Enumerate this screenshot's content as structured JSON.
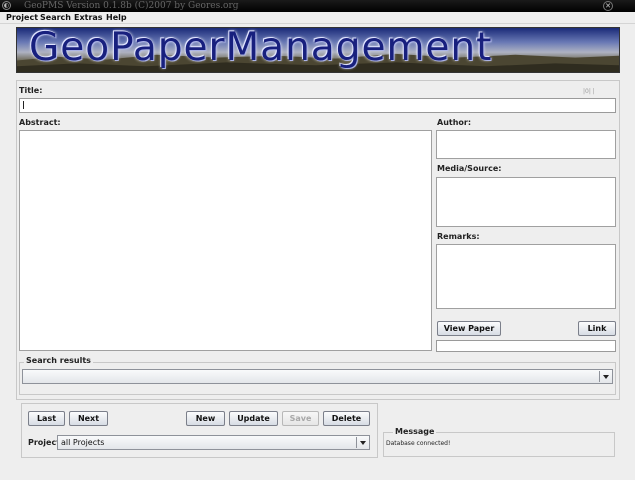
{
  "window": {
    "title": "GeoPMS Version 0.1.8b  (C)2007 by Geores.org",
    "close_glyph": "✕",
    "app_glyph": "◐"
  },
  "menu": [
    {
      "label": "Project"
    },
    {
      "label": "Search"
    },
    {
      "label": "Extras"
    },
    {
      "label": "Help"
    }
  ],
  "banner": {
    "title": "GeoPaperManagement"
  },
  "form": {
    "title_label": "Title:",
    "title_value": "",
    "title_counter": "|0|  |",
    "abstract_label": "Abstract:",
    "abstract_value": "",
    "author_label": "Author:",
    "author_value": "",
    "media_label": "Media/Source:",
    "media_value": "",
    "remarks_label": "Remarks:",
    "remarks_value": "",
    "view_paper_label": "View Paper",
    "link_label": "Link",
    "link_value": ""
  },
  "search_results": {
    "group_title": "Search results",
    "selected": ""
  },
  "navigation": {
    "last_label": "Last",
    "next_label": "Next",
    "new_label": "New",
    "update_label": "Update",
    "save_label": "Save",
    "delete_label": "Delete",
    "project_label": "Project:",
    "project_selected": "all Projects"
  },
  "message": {
    "group_title": "Message",
    "text": "Database connected!"
  }
}
